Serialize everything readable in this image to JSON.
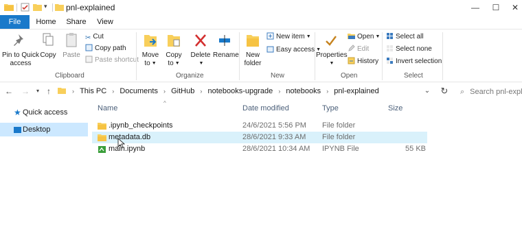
{
  "window": {
    "title": "pnl-explained",
    "controls": {
      "minimize": "—",
      "maximize": "☐",
      "close": "✕"
    }
  },
  "tabs": [
    "File",
    "Home",
    "Share",
    "View"
  ],
  "ribbon": {
    "clipboard": {
      "label": "Clipboard",
      "pin_line1": "Pin to Quick",
      "pin_line2": "access",
      "copy": "Copy",
      "paste": "Paste",
      "cut": "Cut",
      "copy_path": "Copy path",
      "paste_shortcut": "Paste shortcut"
    },
    "organize": {
      "label": "Organize",
      "move_line1": "Move",
      "move_line2": "to",
      "copy_line1": "Copy",
      "copy_line2": "to",
      "delete": "Delete",
      "rename": "Rename"
    },
    "new": {
      "label": "New",
      "new_folder_line1": "New",
      "new_folder_line2": "folder",
      "new_item": "New item",
      "easy_access": "Easy access"
    },
    "open": {
      "label": "Open",
      "properties": "Properties",
      "open": "Open",
      "edit": "Edit",
      "history": "History"
    },
    "select": {
      "label": "Select",
      "select_all": "Select all",
      "select_none": "Select none",
      "invert_selection": "Invert selection"
    }
  },
  "address": {
    "crumbs": [
      "This PC",
      "Documents",
      "GitHub",
      "notebooks-upgrade",
      "notebooks",
      "pnl-explained"
    ],
    "search_placeholder": "Search pnl-expl"
  },
  "nav_pane": [
    {
      "label": "Quick access",
      "icon": "star-icon",
      "selected": false
    },
    {
      "label": "Desktop",
      "icon": "desktop-icon",
      "selected": true
    }
  ],
  "columns": {
    "name": "Name",
    "date": "Date modified",
    "type": "Type",
    "size": "Size"
  },
  "files": [
    {
      "name": ".ipynb_checkpoints",
      "date": "24/6/2021 5:56 PM",
      "type": "File folder",
      "size": "",
      "icon": "folder-icon"
    },
    {
      "name": "metadata.db",
      "date": "28/6/2021 9:33 AM",
      "type": "File folder",
      "size": "",
      "icon": "folder-icon"
    },
    {
      "name": "main.ipynb",
      "date": "28/6/2021 10:34 AM",
      "type": "IPYNB File",
      "size": "55 KB",
      "icon": "notebook-icon"
    }
  ],
  "colors": {
    "accent": "#1979ca",
    "selection": "#cce8ff",
    "hover": "#d9f1fb",
    "folder": "#f8cf5b"
  }
}
